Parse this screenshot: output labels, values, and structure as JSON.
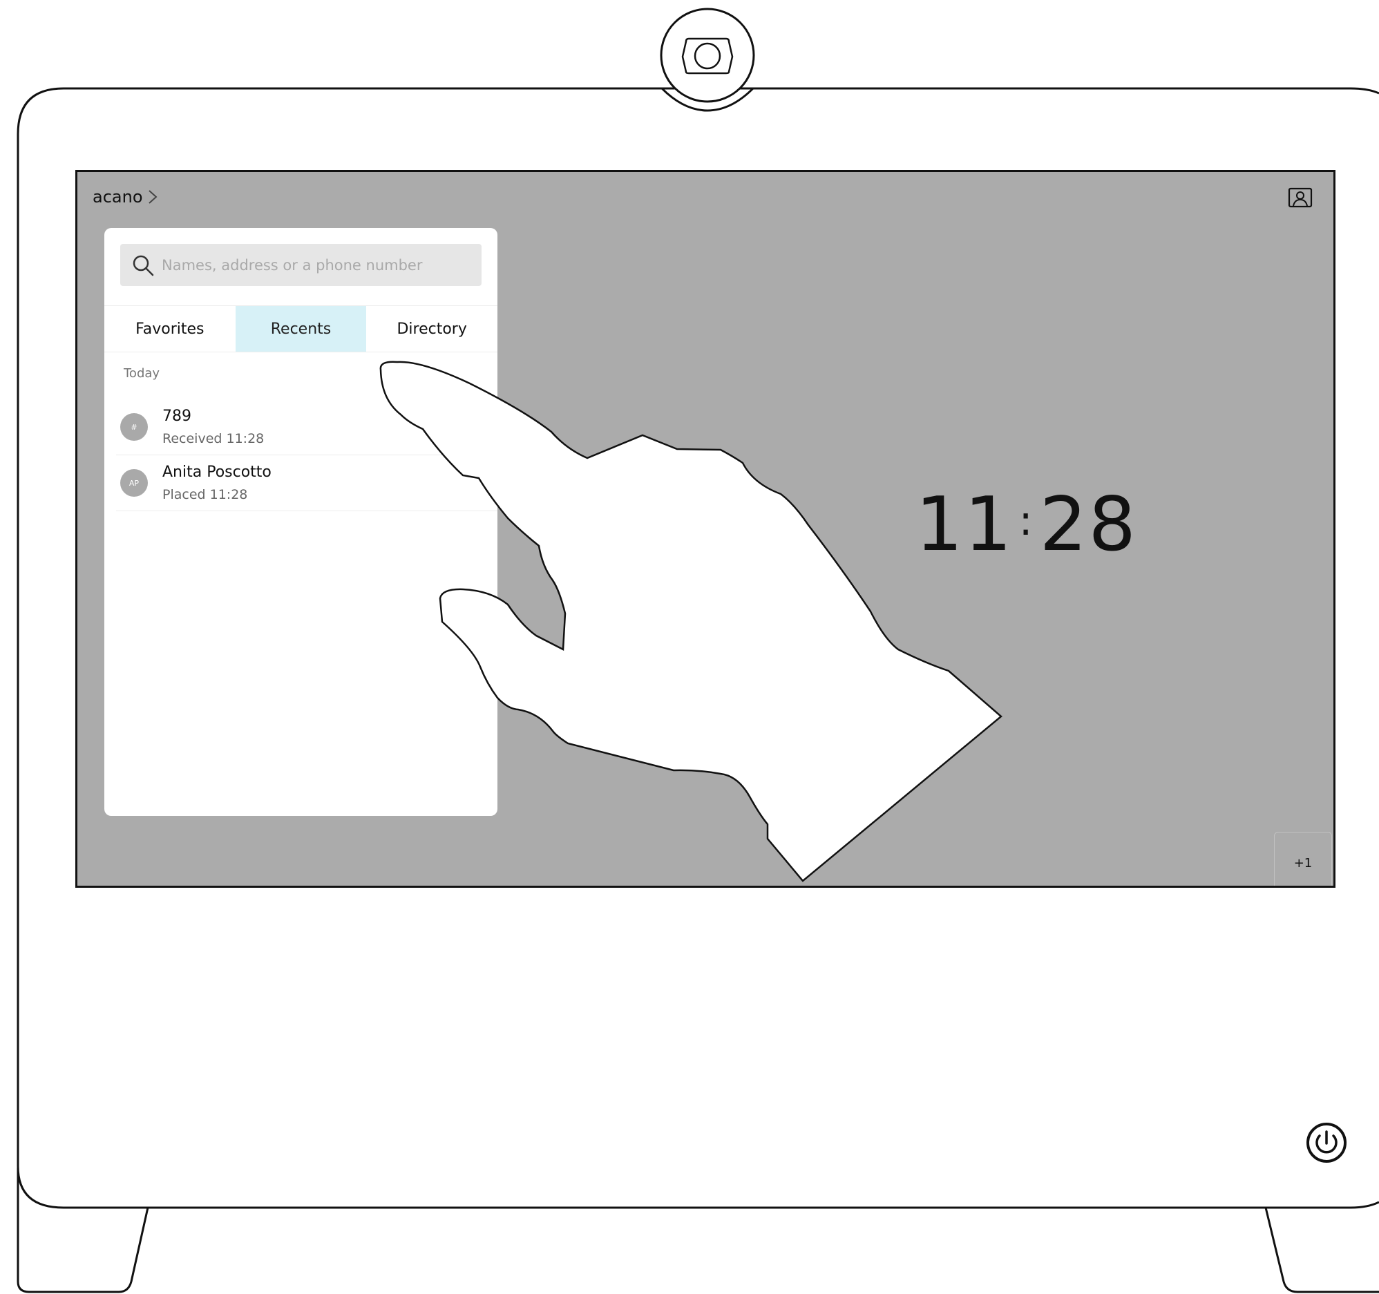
{
  "topbar": {
    "device_name": "acano"
  },
  "search": {
    "placeholder": "Names, address or a phone number"
  },
  "tabs": [
    {
      "label": "Favorites",
      "active": false
    },
    {
      "label": "Recents",
      "active": true
    },
    {
      "label": "Directory",
      "active": false
    }
  ],
  "recents": {
    "section_label": "Today",
    "items": [
      {
        "avatar": "#",
        "name": "789",
        "detail": "Received 11:28"
      },
      {
        "avatar": "AP",
        "name": "Anita Poscotto",
        "detail": "Placed 11:28"
      }
    ]
  },
  "clock": {
    "hours": "11",
    "minutes": "28"
  },
  "participants_badge": "+1",
  "icons": {
    "camera": "camera-icon",
    "chevron": "chevron-right-icon",
    "selfview": "selfview-icon",
    "search": "search-icon",
    "power": "power-icon",
    "hand": "pointing-hand-icon"
  },
  "colors": {
    "screen_background": "#ababab",
    "active_tab": "#d7f1f7",
    "avatar": "#a9a9a9"
  }
}
